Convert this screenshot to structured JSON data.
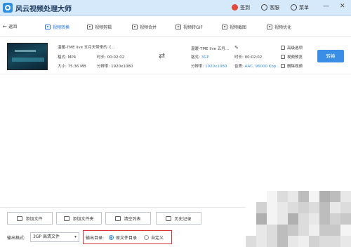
{
  "app": {
    "title": "风云视频处理大师",
    "header": {
      "check_in": "签到",
      "support": "客服",
      "menu": "菜单"
    }
  },
  "nav": {
    "back": "返回",
    "tabs": [
      {
        "label": "视频转换",
        "active": true
      },
      {
        "label": "视频剪辑",
        "active": false
      },
      {
        "label": "视频合并",
        "active": false
      },
      {
        "label": "视频转GIF",
        "active": false
      },
      {
        "label": "视频截图",
        "active": false
      },
      {
        "label": "视频优化",
        "active": false
      }
    ]
  },
  "file": {
    "source": {
      "name": "温暖-TME live 五月天带来的《...",
      "format": "格式: MP4",
      "duration": "时长: 00:02:02",
      "size": "大小: 75.36 MB",
      "resolution": "分辨率: 1920x1080"
    },
    "output": {
      "name": "温暖-TME live 五月...",
      "format_label": "格式:",
      "format_value": "3GP",
      "duration": "时长: 00:02:02",
      "resolution_label": "分辨率:",
      "resolution_value": "1920x1080",
      "audio_label": "音质:",
      "audio_value": "AAC, 96000 Kbp..."
    },
    "side_links": [
      "高级选项",
      "视频预览",
      "删除视频"
    ],
    "convert_button": "转换"
  },
  "bottom": {
    "buttons": [
      "添加文件",
      "添加文件夹",
      "清空列表",
      "历史记录"
    ],
    "output_format_label": "输出格式:",
    "output_format_value": "3GP 高清文件",
    "output_dir_label": "输出目录:",
    "dir_options": [
      {
        "label": "原文件目录",
        "selected": true
      },
      {
        "label": "自定义",
        "selected": false
      }
    ]
  },
  "colors": {
    "accent": "#3a8ee6",
    "titlebar": "#d6e9fb",
    "highlight_box": "#d33a3a"
  }
}
